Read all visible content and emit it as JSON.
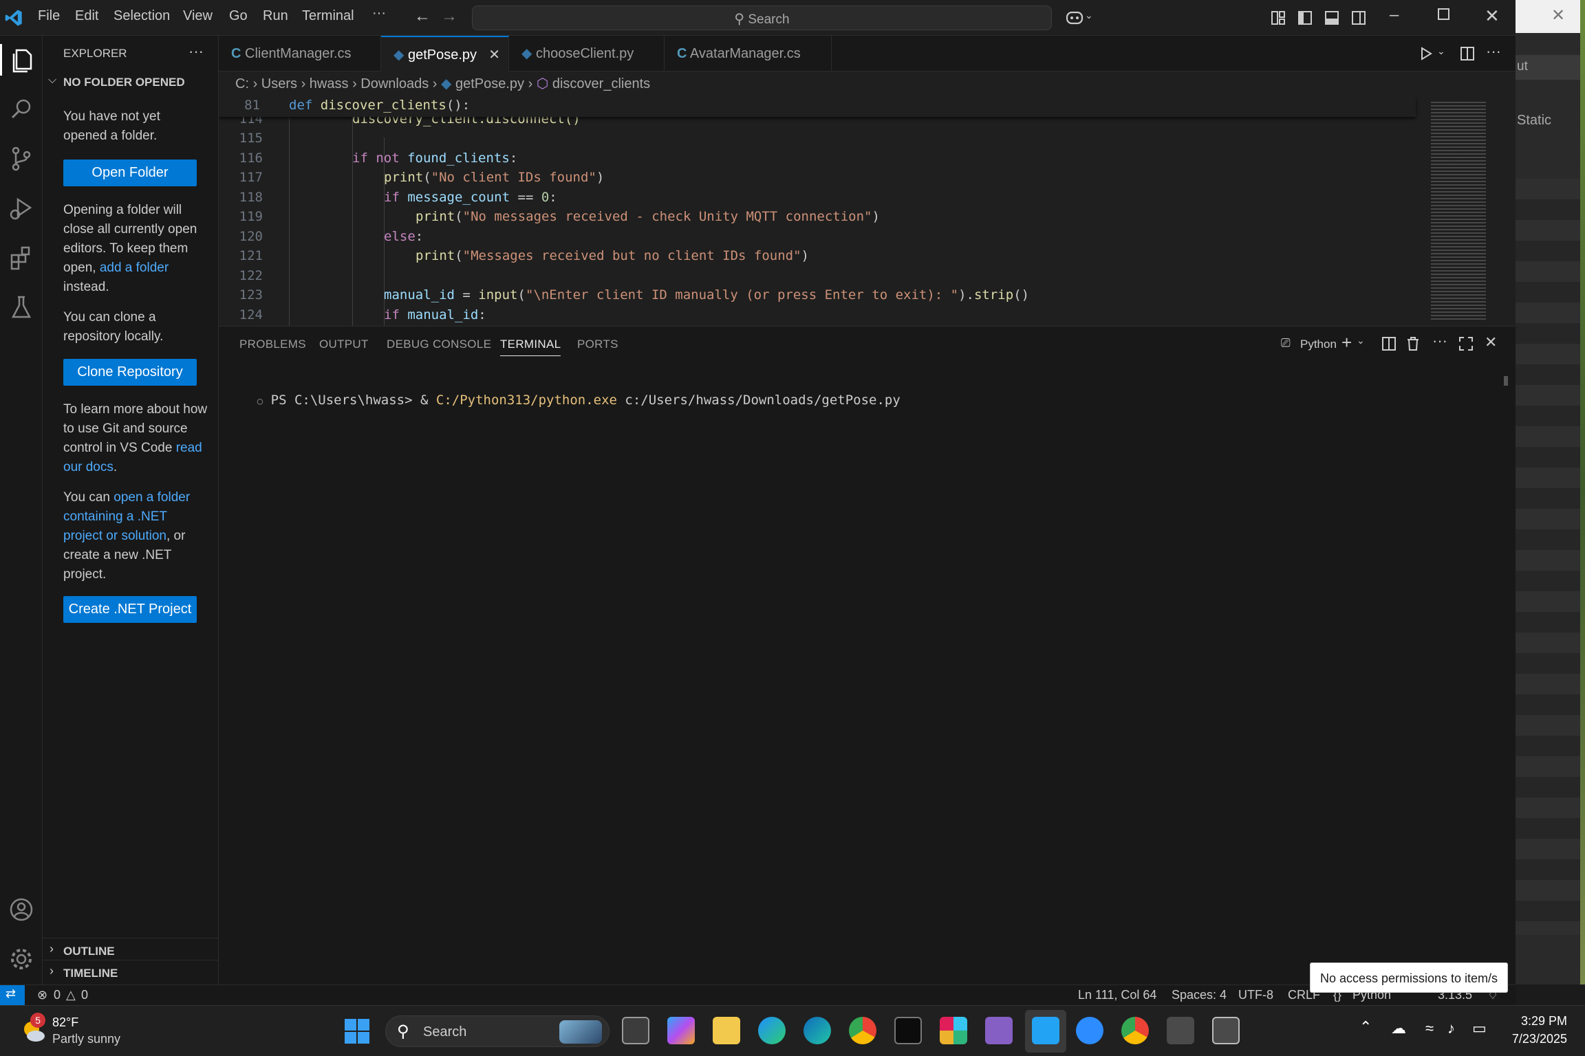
{
  "menu": [
    "File",
    "Edit",
    "Selection",
    "View",
    "Go",
    "Run",
    "Terminal",
    "···"
  ],
  "command_center": {
    "label": "Search"
  },
  "sidebar": {
    "title": "EXPLORER",
    "section": "NO FOLDER OPENED",
    "msg1": "You have not yet opened a folder.",
    "open_folder": "Open Folder",
    "msg2_pre": "Opening a folder will close all currently open editors. To keep them open, ",
    "msg2_link": "add a folder",
    "msg2_post": " instead.",
    "msg3": "You can clone a repository locally.",
    "clone_repo": "Clone Repository",
    "msg4_pre": "To learn more about how to use Git and source control in VS Code ",
    "msg4_link": "read our docs",
    "msg4_post": ".",
    "msg5_pre": "You can ",
    "msg5_link": "open a folder containing a .NET project or solution",
    "msg5_post": ", or create a new .NET project.",
    "create_net": "Create .NET Project",
    "outline": "OUTLINE",
    "timeline": "TIMELINE"
  },
  "tabs": [
    {
      "label": "ClientManager.cs",
      "color": "#519aba"
    },
    {
      "label": "getPose.py",
      "color": "#3572a5"
    },
    {
      "label": "chooseClient.py",
      "color": "#3572a5"
    },
    {
      "label": "AvatarManager.cs",
      "color": "#519aba"
    }
  ],
  "breadcrumb": [
    "C:",
    "Users",
    "hwass",
    "Downloads",
    "getPose.py",
    "discover_clients"
  ],
  "editor": {
    "sticky_line": "81",
    "sticky_kw": "def",
    "sticky_fn": "discover_clients",
    "sticky_rest": "():",
    "lines": {
      "l114": "114",
      "l115": "115",
      "l116": "116",
      "l117": "117",
      "l118": "118",
      "l119": "119",
      "l120": "120",
      "l121": "121",
      "l122": "122",
      "l123": "123",
      "l124": "124"
    },
    "c114": "discovery_client.disconnect()",
    "c116_kw": "if not",
    "c116_var": "found_clients",
    "c117_fn": "print",
    "c117_str": "\"No client IDs found\"",
    "c118_kw": "if",
    "c118_var": "message_count",
    "c118_op": " == ",
    "c118_num": "0",
    "c119_fn": "print",
    "c119_str": "\"No messages received - check Unity MQTT connection\"",
    "c120_kw": "else",
    "c121_fn": "print",
    "c121_str": "\"Messages received but no client IDs found\"",
    "c123_var": "manual_id",
    "c123_fn": "input",
    "c123_str": "\"\\nEnter client ID manually (or press Enter to exit): \"",
    "c123_fn2": "strip",
    "c124_kw": "if",
    "c124_var": "manual_id"
  },
  "panel": {
    "tabs": [
      "PROBLEMS",
      "OUTPUT",
      "DEBUG CONSOLE",
      "TERMINAL",
      "PORTS"
    ],
    "shell": "Python",
    "prompt": "PS C:\\Users\\hwass> & ",
    "exe": "C:/Python313/python.exe",
    "arg": " c:/Users/hwass/Downloads/getPose.py"
  },
  "bgwin": {
    "text1": "ut",
    "text2": "Static"
  },
  "status": {
    "errors": "0",
    "warnings": "0",
    "position": "Ln 111, Col 64",
    "spaces": "Spaces: 4",
    "encoding": "UTF-8",
    "eol": "CRLF",
    "language": "Python",
    "version": "3.13.5"
  },
  "toast": "No access permissions to item/s",
  "taskbar": {
    "weather_temp": "82°F",
    "weather_desc": "Partly sunny",
    "weather_badge": "5",
    "search": "Search",
    "time": "3:29 PM",
    "date": "7/23/2025"
  }
}
